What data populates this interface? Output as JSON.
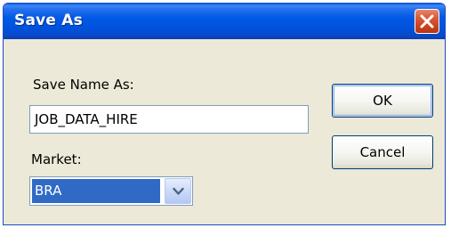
{
  "window": {
    "title": "Save As"
  },
  "form": {
    "save_name_label": "Save Name As:",
    "save_name_value": "JOB_DATA_HIRE",
    "market_label": "Market:",
    "market_selected": "BRA"
  },
  "buttons": {
    "ok_label": "OK",
    "cancel_label": "Cancel"
  },
  "icons": {
    "close": "close-icon",
    "dropdown": "chevron-down-icon"
  },
  "colors": {
    "titlebar": "#0058e6",
    "close_button": "#d95b36",
    "dialog_background": "#ece9d8",
    "selection_highlight": "#316ac5"
  }
}
